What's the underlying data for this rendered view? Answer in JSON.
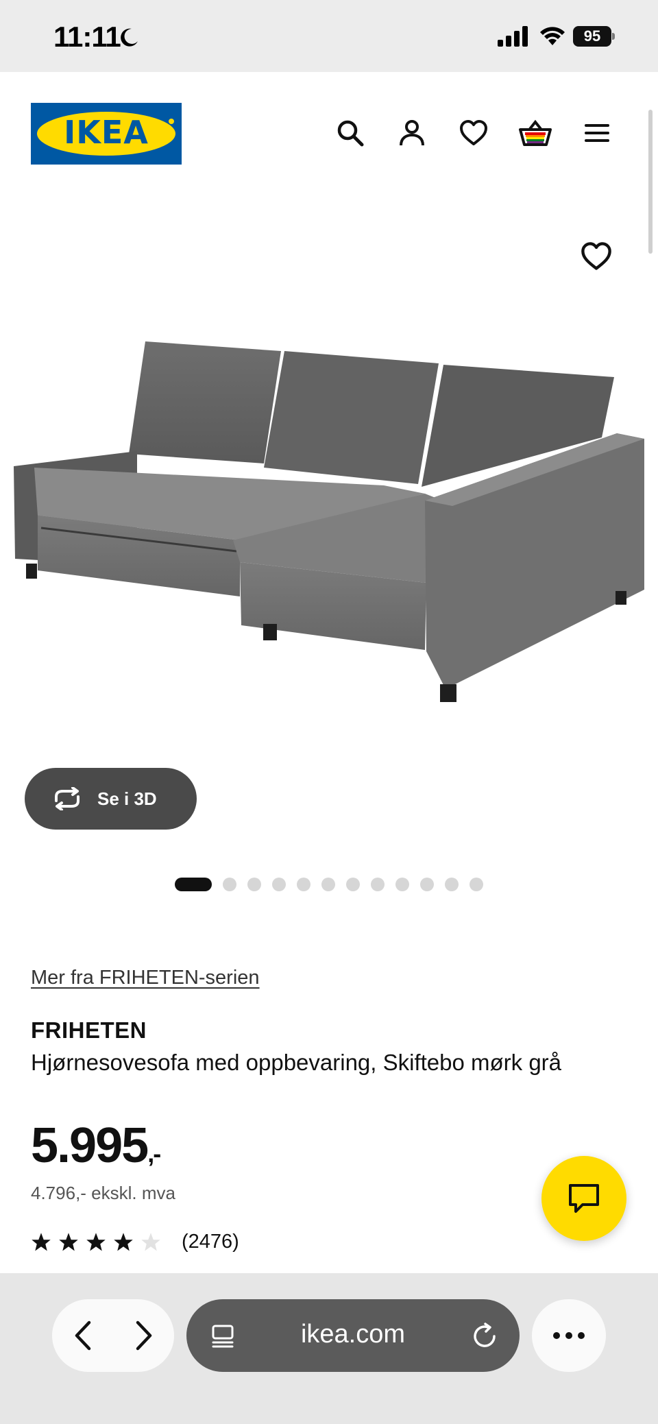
{
  "status_bar": {
    "time": "11:11",
    "battery": "95"
  },
  "header": {
    "logo_text": "IKEA",
    "icons": [
      "search-icon",
      "account-icon",
      "favourites-heart-icon",
      "shopping-bag-icon",
      "menu-icon"
    ]
  },
  "product": {
    "image_alt": "FRIHETEN corner sofa-bed, dark grey",
    "view_3d_label": "Se i 3D",
    "image_count": 12,
    "active_image_index": 0,
    "series_link": "Mer fra FRIHETEN-serien",
    "name": "FRIHETEN",
    "description": "Hjørnesovesofa med oppbevaring, Skiftebo mørk grå",
    "price": "5.995",
    "price_suffix": ",-",
    "price_ex_vat": "4.796,- ekskl. mva",
    "rating_stars": 4,
    "rating_max": 5,
    "rating_count": "(2476)"
  },
  "browser": {
    "url": "ikea.com"
  },
  "colors": {
    "ikea_blue": "#0058a3",
    "ikea_yellow": "#ffdb00",
    "dark_button": "#4a4a4a"
  }
}
